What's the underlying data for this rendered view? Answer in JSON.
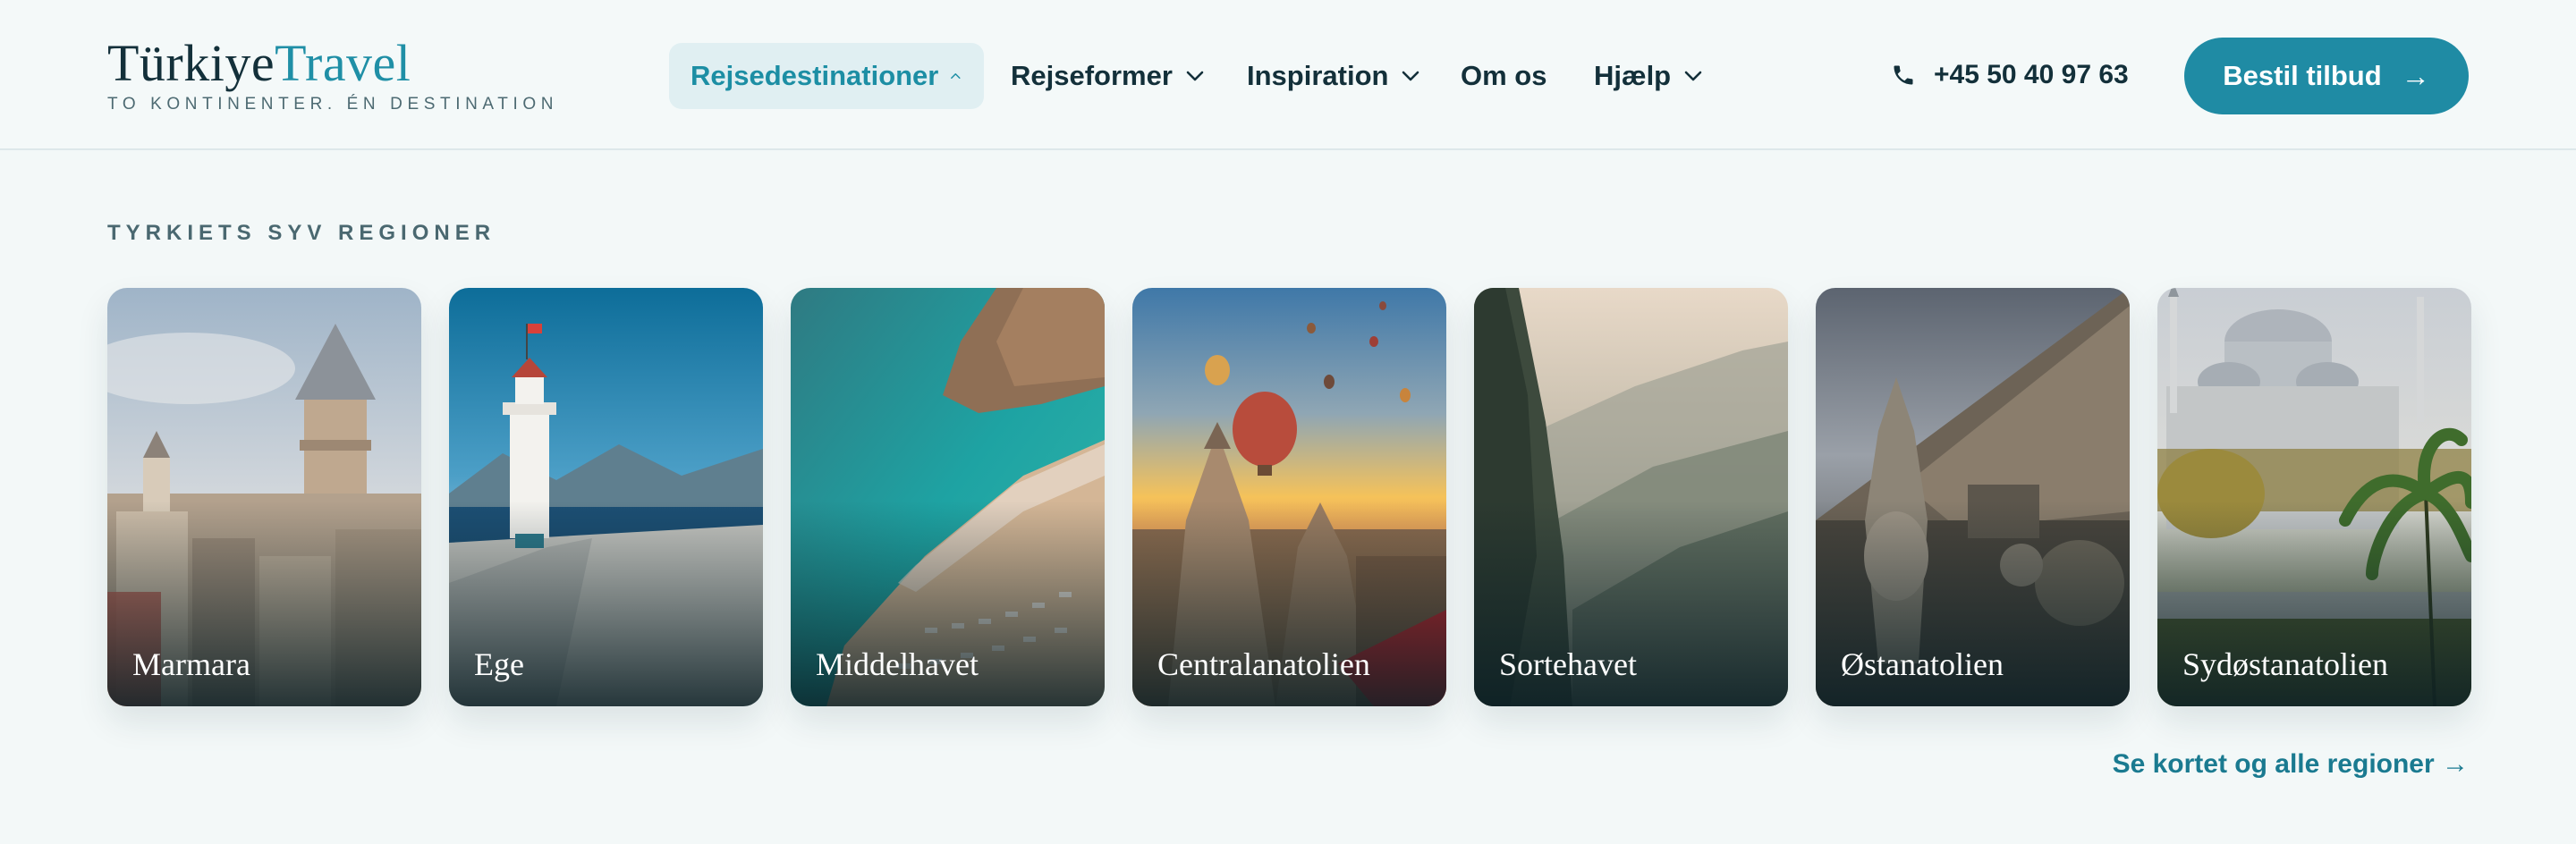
{
  "brand": {
    "name_part1": "Türkiye",
    "name_part2": "Travel",
    "tagline": "TO KONTINENTER. ÉN DESTINATION"
  },
  "nav": {
    "items": [
      {
        "label": "Rejsedestinationer",
        "icon": "chevron-up-icon",
        "active": true
      },
      {
        "label": "Rejseformer",
        "icon": "chevron-down-icon",
        "active": false
      },
      {
        "label": "Inspiration",
        "icon": "chevron-down-icon",
        "active": false
      },
      {
        "label": "Om os",
        "icon": "",
        "active": false
      },
      {
        "label": "Hjælp",
        "icon": "chevron-down-icon",
        "active": false
      }
    ]
  },
  "contact": {
    "phone": "+45 50 40 97 63",
    "icon": "phone-icon"
  },
  "cta": {
    "label": "Bestil tilbud",
    "arrow": "→"
  },
  "regions": {
    "heading": "TYRKIETS SYV REGIONER",
    "cards": [
      {
        "name": "Marmara"
      },
      {
        "name": "Ege"
      },
      {
        "name": "Middelhavet"
      },
      {
        "name": "Centralanatolien"
      },
      {
        "name": "Sortehavet"
      },
      {
        "name": "Østanatolien"
      },
      {
        "name": "Sydøstanatolien"
      }
    ],
    "map_link": "Se kortet og alle regioner →"
  },
  "colors": {
    "accent": "#1f8ba4",
    "text": "#13303a",
    "background": "#f3f8f8"
  }
}
